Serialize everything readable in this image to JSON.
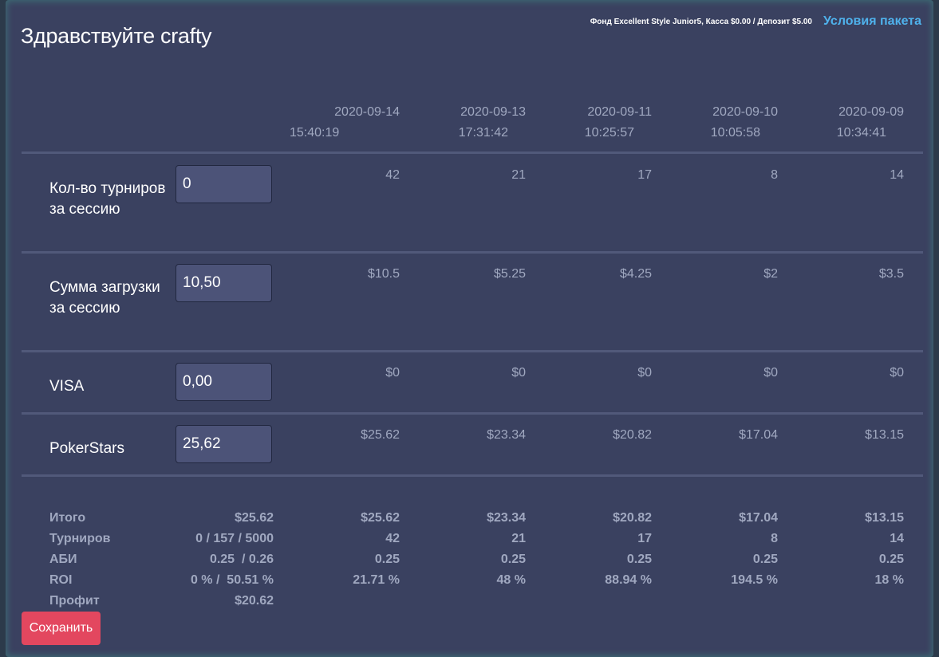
{
  "header": {
    "greeting": "Здравствуйте crafty",
    "fund_info": "Фонд Excellent Style Junior5, Касса $0.00 / Депозит $5.00",
    "terms_link": "Условия пакета"
  },
  "sessions": [
    {
      "date": "2020-09-14",
      "time": "15:40:19"
    },
    {
      "date": "2020-09-13",
      "time": "17:31:42"
    },
    {
      "date": "2020-09-11",
      "time": "10:25:57"
    },
    {
      "date": "2020-09-10",
      "time": "10:05:58"
    },
    {
      "date": "2020-09-09",
      "time": "10:34:41"
    }
  ],
  "rows": [
    {
      "label": "Кол-во турниров за сессию",
      "input": "0",
      "values": [
        "42",
        "21",
        "17",
        "8",
        "14"
      ]
    },
    {
      "label": "Сумма загрузки за сессию",
      "input": "10,50",
      "values": [
        "$10.5",
        "$5.25",
        "$4.25",
        "$2",
        "$3.5"
      ]
    },
    {
      "label": "VISA",
      "input": "0,00",
      "values": [
        "$0",
        "$0",
        "$0",
        "$0",
        "$0"
      ]
    },
    {
      "label": "PokerStars",
      "input": "25,62",
      "values": [
        "$25.62",
        "$23.34",
        "$20.82",
        "$17.04",
        "$13.15"
      ]
    }
  ],
  "summary": [
    {
      "label": "Итого",
      "total": "$25.62",
      "values": [
        "$25.62",
        "$23.34",
        "$20.82",
        "$17.04",
        "$13.15"
      ]
    },
    {
      "label": "Турниров",
      "total": "0 / 157 / 5000",
      "values": [
        "42",
        "21",
        "17",
        "8",
        "14"
      ]
    },
    {
      "label": "АБИ",
      "total": "0.25  / 0.26",
      "values": [
        "0.25",
        "0.25",
        "0.25",
        "0.25",
        "0.25"
      ]
    },
    {
      "label": "ROI",
      "total": "0 % /  50.51 %",
      "values": [
        "21.71 %",
        "48 %",
        "88.94 %",
        "194.5 %",
        "18 %"
      ]
    },
    {
      "label": "Профит",
      "total": "$20.62",
      "values": [
        "",
        "",
        "",
        "",
        ""
      ]
    }
  ],
  "actions": {
    "save_label": "Сохранить"
  },
  "colors": {
    "background": "#3a4160",
    "accent_link": "#4fb2ec",
    "save_button": "#e3475f"
  }
}
